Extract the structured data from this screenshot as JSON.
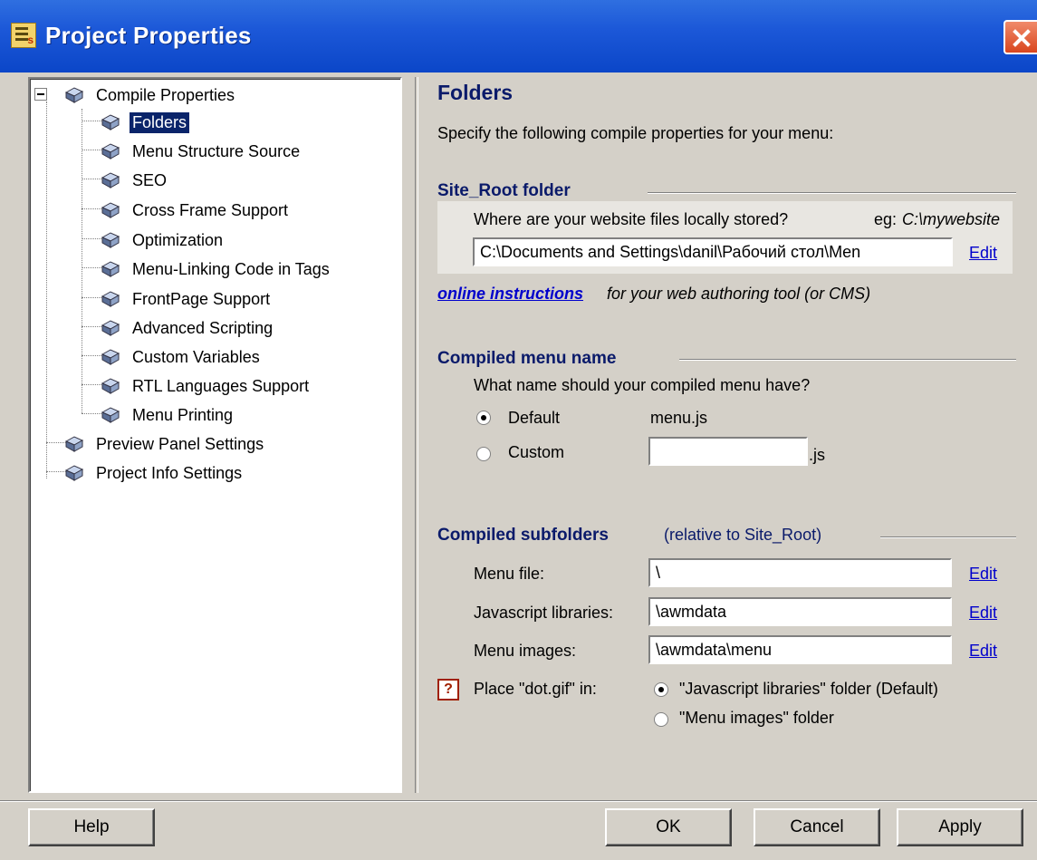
{
  "window": {
    "title": "Project Properties",
    "icon_badge": "s"
  },
  "tree": {
    "root": "Compile Properties",
    "children": [
      "Folders",
      "Menu Structure Source",
      "SEO",
      "Cross Frame Support",
      "Optimization",
      "Menu-Linking Code in Tags",
      "FrontPage Support",
      "Advanced Scripting",
      "Custom Variables",
      "RTL Languages Support",
      "Menu Printing"
    ],
    "top_items": [
      "Preview Panel Settings",
      "Project Info Settings"
    ],
    "selected": "Folders"
  },
  "panel": {
    "title": "Folders",
    "intro": "Specify the following compile properties for your menu:",
    "site_root": {
      "heading": "Site_Root folder",
      "question": "Where are your website files locally stored?",
      "example_prefix": "eg:",
      "example_value": "C:\\mywebsite",
      "path_value": "C:\\Documents and Settings\\danil\\Рабочий стол\\Men",
      "edit": "Edit",
      "online_link": "online instructions",
      "online_suffix": "for your web authoring tool (or CMS)"
    },
    "compiled_name": {
      "heading": "Compiled menu name",
      "question": "What name should your compiled menu have?",
      "default_label": "Default",
      "default_value": "menu.js",
      "custom_label": "Custom",
      "custom_value": "",
      "custom_suffix": ".js",
      "selected": "Default"
    },
    "subfolders": {
      "heading": "Compiled subfolders",
      "note": "(relative to Site_Root)",
      "menu_file_label": "Menu file:",
      "menu_file_value": "\\",
      "js_libs_label": "Javascript libraries:",
      "js_libs_value": "\\awmdata",
      "menu_images_label": "Menu images:",
      "menu_images_value": "\\awmdata\\menu",
      "edit": "Edit",
      "dotgif_label": "Place \"dot.gif\" in:",
      "dotgif_option1": "\"Javascript libraries\" folder (Default)",
      "dotgif_option2": "\"Menu images\" folder",
      "dotgif_selected": "option1",
      "help_glyph": "?"
    }
  },
  "buttons": {
    "help": "Help",
    "ok": "OK",
    "cancel": "Cancel",
    "apply": "Apply"
  }
}
